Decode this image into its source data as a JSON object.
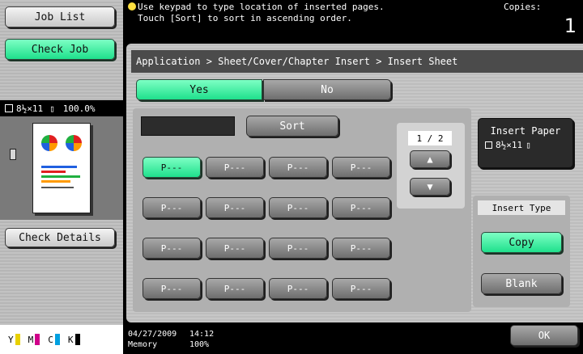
{
  "left_panel": {
    "job_list_label": "Job List",
    "check_job_label": "Check Job",
    "paper_size": "8½×11",
    "zoom": "100.0%",
    "check_details_label": "Check Details",
    "toners": [
      "Y",
      "M",
      "C",
      "K"
    ]
  },
  "message": {
    "line1": "Use keypad to type location of inserted pages.",
    "line2": "Touch [Sort] to sort in ascending order.",
    "copies_label": "Copies:",
    "copies_value": "1"
  },
  "breadcrumb": "Application > Sheet/Cover/Chapter Insert > Insert Sheet",
  "toggle": {
    "yes_label": "Yes",
    "no_label": "No",
    "selected": "Yes"
  },
  "input": {
    "value": ""
  },
  "sort_label": "Sort",
  "page_indicator": "1 / 2",
  "page_buttons": [
    "P---",
    "P---",
    "P---",
    "P---",
    "P---",
    "P---",
    "P---",
    "P---",
    "P---",
    "P---",
    "P---",
    "P---",
    "P---",
    "P---",
    "P---",
    "P---"
  ],
  "insert_paper": {
    "label": "Insert Paper",
    "paper": "8½×11"
  },
  "insert_type": {
    "title": "Insert Type",
    "copy_label": "Copy",
    "blank_label": "Blank",
    "selected": "Copy"
  },
  "ok_label": "OK",
  "status_bar": {
    "date": "04/27/2009",
    "time": "14:12",
    "memory_label": "Memory",
    "memory_value": "100%"
  }
}
